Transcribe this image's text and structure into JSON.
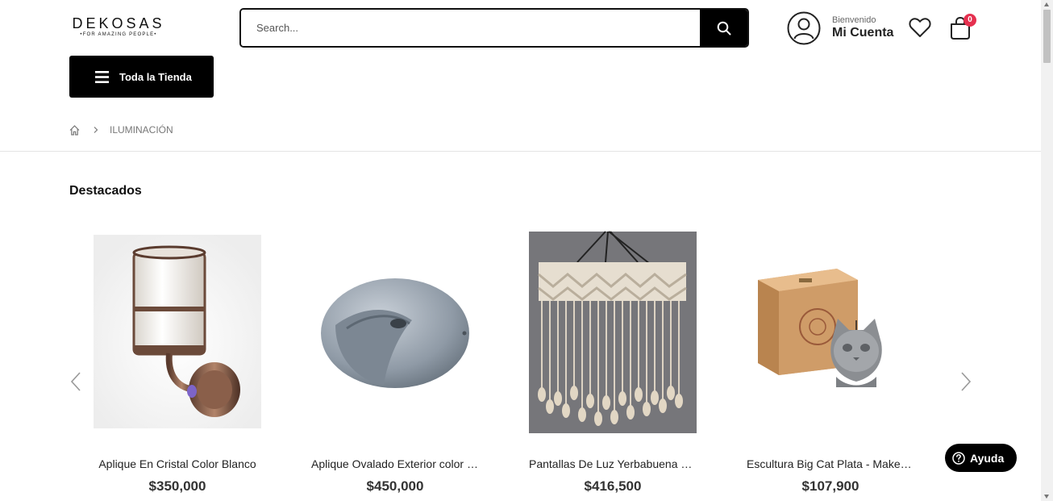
{
  "header": {
    "logo_main": "DEKOSAS",
    "logo_sub": "•FOR AMAZING PEOPLE•",
    "search_placeholder": "Search...",
    "account_welcome": "Bienvenido",
    "account_name": "Mi Cuenta",
    "cart_count": "0"
  },
  "nav": {
    "store_button_label": "Toda la Tienda"
  },
  "breadcrumb": {
    "current": "ILUMINACIÓN"
  },
  "section": {
    "title": "Destacados"
  },
  "products": [
    {
      "name": "Aplique En Cristal Color Blanco",
      "price": "$350,000"
    },
    {
      "name": "Aplique Ovalado Exterior color Gris",
      "price": "$450,000"
    },
    {
      "name": "Pantallas De Luz Yerbabuena Macramé",
      "price": "$416,500"
    },
    {
      "name": "Escultura Big Cat Plata - Make Burn",
      "price": "$107,900"
    }
  ],
  "help": {
    "label": "Ayuda"
  },
  "colors": {
    "primary": "#000000",
    "badge": "#e5304f",
    "text": "#222222"
  }
}
